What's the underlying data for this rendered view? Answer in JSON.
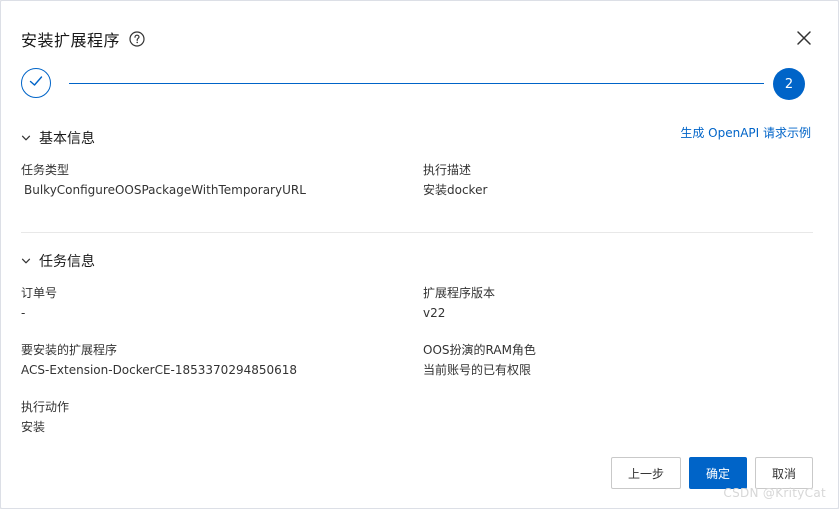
{
  "dialog": {
    "title": "安装扩展程序",
    "help_icon": "question-circle-icon",
    "close_icon": "close-icon"
  },
  "stepper": {
    "completed_icon": "check-icon",
    "current_step": "2"
  },
  "basic_info": {
    "heading": "基本信息",
    "openapi_link": "生成 OpenAPI 请求示例",
    "task_type_label": "任务类型",
    "task_type_value": "BulkyConfigureOOSPackageWithTemporaryURL",
    "exec_desc_label": "执行描述",
    "exec_desc_value": "安装docker"
  },
  "task_info": {
    "heading": "任务信息",
    "order_label": "订单号",
    "order_value": "-",
    "ext_version_label": "扩展程序版本",
    "ext_version_value": "v22",
    "ext_to_install_label": "要安装的扩展程序",
    "ext_to_install_value": "ACS-Extension-DockerCE-1853370294850618",
    "ram_role_label": "OOS扮演的RAM角色",
    "ram_role_value": "当前账号的已有权限",
    "action_label": "执行动作",
    "action_value": "安装"
  },
  "footer": {
    "prev_label": "上一步",
    "confirm_label": "确定",
    "cancel_label": "取消"
  },
  "watermark": "CSDN @KrityCat",
  "colors": {
    "primary": "#0064c8",
    "text": "#333333"
  }
}
